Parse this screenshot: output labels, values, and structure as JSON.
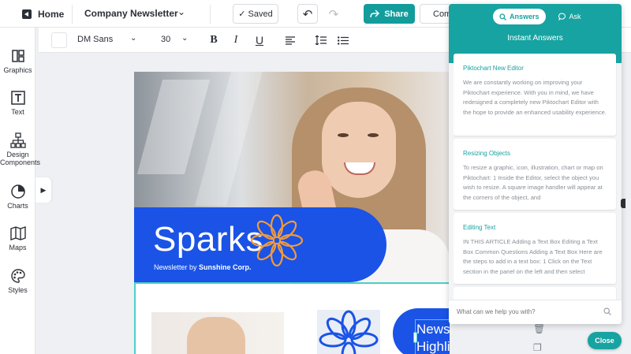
{
  "topbar": {
    "home_label": "Home",
    "doc_title": "Company Newsletter",
    "saved_label": "Saved",
    "share_label": "Share",
    "comment_label": "Comment"
  },
  "format": {
    "font_name": "DM Sans",
    "font_size": "30"
  },
  "sidebar": {
    "items": [
      {
        "label": "Graphics",
        "icon": "graphics-icon"
      },
      {
        "label": "Text",
        "icon": "text-icon"
      },
      {
        "label": "Design Components",
        "icon": "hierarchy-icon"
      },
      {
        "label": "Charts",
        "icon": "pie-chart-icon"
      },
      {
        "label": "Maps",
        "icon": "map-icon"
      },
      {
        "label": "Styles",
        "icon": "palette-icon"
      }
    ]
  },
  "canvas": {
    "hero_title": "Sparks",
    "hero_sub_prefix": "Newsletter by ",
    "hero_sub_brand": "Sunshine Corp.",
    "highlight_line1": "Newsletter",
    "highlight_line2": "Highlights",
    "colors": {
      "brand_blue": "#1a53e6",
      "accent_orange": "#f29a3a",
      "selection": "#4ccfc6"
    }
  },
  "help": {
    "tabs": [
      {
        "label": "Answers",
        "icon": "search-icon",
        "active": true
      },
      {
        "label": "Ask",
        "icon": "chat-heart-icon",
        "active": false
      }
    ],
    "title": "Instant Answers",
    "articles": [
      {
        "title": "Piktochart New Editor",
        "body": "We are constantly working on improving your Piktochart experience. With you in mind, we have redesigned a completely new Piktochart Editor with the hope to provide an enhanced usability experience."
      },
      {
        "title": "Resizing Objects",
        "body": "To resize a graphic, icon, illustration, chart or map on Piktochart: 1 Inside the Editor, select the object you wish to resize. A square image handler will appear at the corners of the object, and"
      },
      {
        "title": "Editing Text",
        "body": "IN THIS ARTICLE Adding a Text Box Editing a Text Box Common Questions Adding a Text Box Here are the steps to add in a text box: 1 Click on the Text section in the panel on the left and then select"
      }
    ],
    "search_placeholder": "What can we help you with?",
    "close_label": "Close",
    "accent": "#17a3a1"
  }
}
